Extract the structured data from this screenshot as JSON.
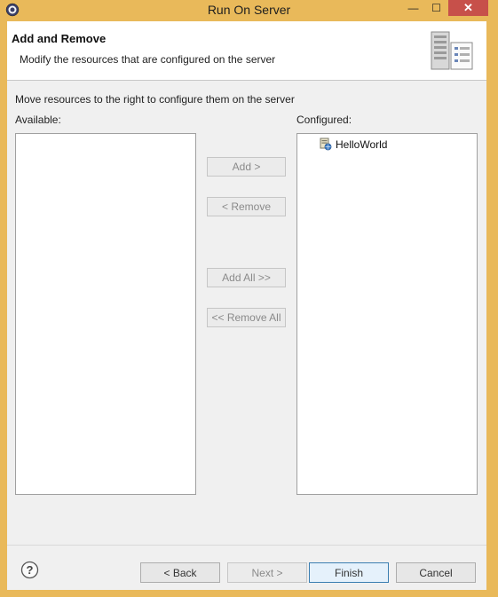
{
  "window": {
    "title": "Run On Server",
    "minimize": "—",
    "maximize": "☐",
    "close": "✕"
  },
  "header": {
    "title": "Add and Remove",
    "description": "Modify the resources that are configured on the server"
  },
  "instruction": "Move resources to the right to configure them on the server",
  "available": {
    "label": "Available:",
    "items": []
  },
  "configured": {
    "label": "Configured:",
    "items": [
      {
        "label": "HelloWorld",
        "icon": "web-module-icon"
      }
    ]
  },
  "buttons": {
    "add": "Add >",
    "remove": "< Remove",
    "add_all": "Add All >>",
    "remove_all": "<< Remove All",
    "back": "< Back",
    "next": "Next >",
    "finish": "Finish",
    "cancel": "Cancel"
  },
  "colors": {
    "frame": "#e9b95a",
    "dialog": "#f0f0f0",
    "close": "#c7504a",
    "default_button_border": "#3c7fb1"
  }
}
